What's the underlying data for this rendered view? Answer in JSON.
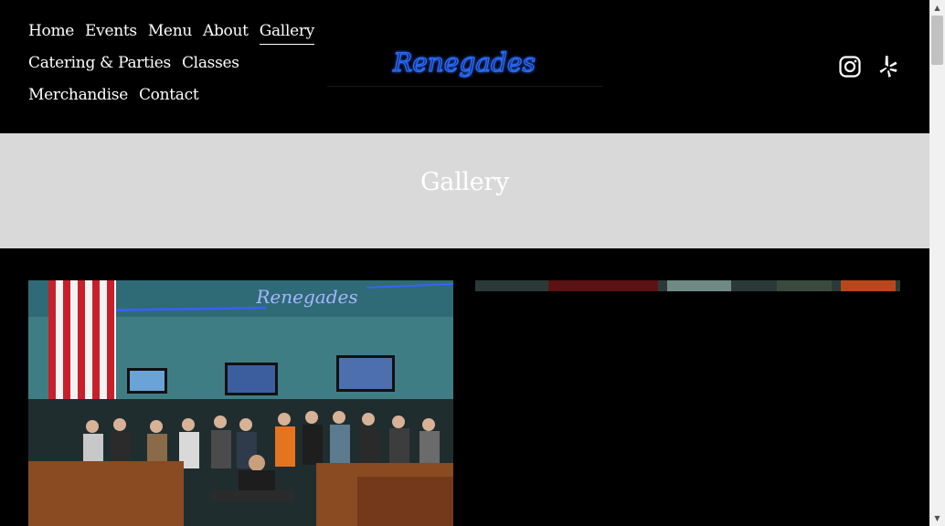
{
  "nav": {
    "rows": [
      [
        "Home",
        "Events",
        "Menu",
        "About",
        "Gallery"
      ],
      [
        "Catering & Parties",
        "Classes"
      ],
      [
        "Merchandise",
        "Contact"
      ]
    ],
    "active": "Gallery"
  },
  "logo": {
    "text": "Renegades",
    "color": "#1e5bff"
  },
  "social": {
    "icons": [
      "instagram-icon",
      "yelp-icon"
    ]
  },
  "banner": {
    "title": "Gallery"
  },
  "gallery": {
    "images": [
      {
        "name": "bowling-night-photo",
        "sign_text": "Renegades"
      },
      {
        "name": "gallery-photo-2"
      }
    ]
  },
  "colors": {
    "background": "#000000",
    "banner": "#d9d9d9",
    "text": "#ffffff",
    "neon": "#1e5bff"
  }
}
